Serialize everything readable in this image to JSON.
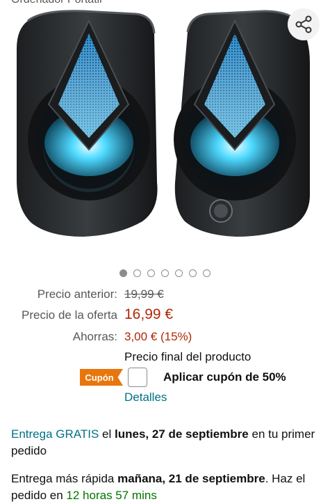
{
  "header": {
    "cut_title": "Ordenador Portátil"
  },
  "pagination": {
    "total": 7,
    "active_index": 0
  },
  "prices": {
    "previous_label": "Precio anterior:",
    "previous_value": "19,99 €",
    "offer_label": "Precio de la oferta",
    "offer_value": "16,99 €",
    "savings_label": "Ahorras:",
    "savings_value": "3,00 € (15%)",
    "final_note": "Precio final del producto"
  },
  "coupon": {
    "badge": "Cupón",
    "apply_label": "Aplicar cupón de 50%",
    "details_link": "Detalles"
  },
  "delivery": {
    "free_link": "Entrega GRATIS",
    "el": "el",
    "date": "lunes, 27 de septiembre",
    "rest": "en tu primer pedido"
  },
  "fast_delivery": {
    "prefix": "Entrega más rápida",
    "date": "mañana, 21 de septiembre",
    "middle": ". Haz el pedido en",
    "countdown": "12 horas 57 mins"
  },
  "colors": {
    "price_red": "#b12704",
    "link_teal": "#007185",
    "coupon_orange": "#e8760d",
    "countdown_green": "#007600"
  }
}
